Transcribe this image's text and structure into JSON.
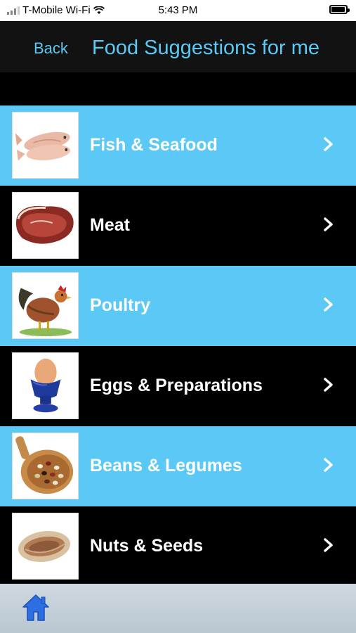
{
  "status_bar": {
    "carrier": "T-Mobile Wi-Fi",
    "time": "5:43 PM"
  },
  "nav": {
    "back_label": "Back",
    "title": "Food Suggestions for me"
  },
  "accent_color": "#5bc8f5",
  "categories": [
    {
      "label": "Fish & Seafood",
      "icon": "fish-icon"
    },
    {
      "label": "Meat",
      "icon": "meat-icon"
    },
    {
      "label": "Poultry",
      "icon": "rooster-icon"
    },
    {
      "label": "Eggs & Preparations",
      "icon": "egg-icon"
    },
    {
      "label": "Beans & Legumes",
      "icon": "beans-icon"
    },
    {
      "label": "Nuts & Seeds",
      "icon": "nut-icon"
    }
  ],
  "tab_bar": {
    "home_icon": "home-icon"
  }
}
